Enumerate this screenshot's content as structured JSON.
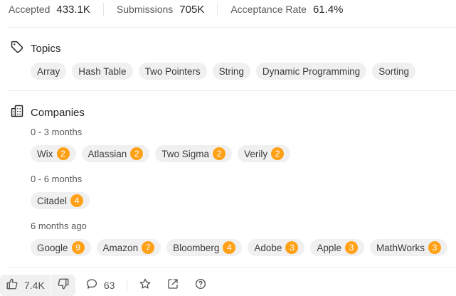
{
  "stats": {
    "accepted_label": "Accepted",
    "accepted_value": "433.1K",
    "submissions_label": "Submissions",
    "submissions_value": "705K",
    "acceptance_label": "Acceptance Rate",
    "acceptance_value": "61.4%"
  },
  "topics": {
    "title": "Topics",
    "icon": "tag-icon",
    "tags": [
      "Array",
      "Hash Table",
      "Two Pointers",
      "String",
      "Dynamic Programming",
      "Sorting"
    ]
  },
  "companies": {
    "title": "Companies",
    "icon": "buildings-icon",
    "groups": [
      {
        "label": "0 - 3 months",
        "items": [
          {
            "name": "Wix",
            "count": "2"
          },
          {
            "name": "Atlassian",
            "count": "2"
          },
          {
            "name": "Two Sigma",
            "count": "2"
          },
          {
            "name": "Verily",
            "count": "2"
          }
        ]
      },
      {
        "label": "0 - 6 months",
        "items": [
          {
            "name": "Citadel",
            "count": "4"
          }
        ]
      },
      {
        "label": "6 months ago",
        "items": [
          {
            "name": "Google",
            "count": "9"
          },
          {
            "name": "Amazon",
            "count": "7"
          },
          {
            "name": "Bloomberg",
            "count": "4"
          },
          {
            "name": "Adobe",
            "count": "3"
          },
          {
            "name": "Apple",
            "count": "3"
          },
          {
            "name": "MathWorks",
            "count": "3"
          }
        ]
      }
    ]
  },
  "footer": {
    "likes": "7.4K",
    "comments": "63",
    "icons": [
      "thumbs-up-icon",
      "thumbs-down-icon",
      "comment-icon",
      "star-icon",
      "share-icon",
      "help-icon"
    ]
  },
  "colors": {
    "badge": "#ffa116",
    "chip_bg": "#f0f0f0",
    "text": "#262626",
    "muted": "#595959"
  }
}
